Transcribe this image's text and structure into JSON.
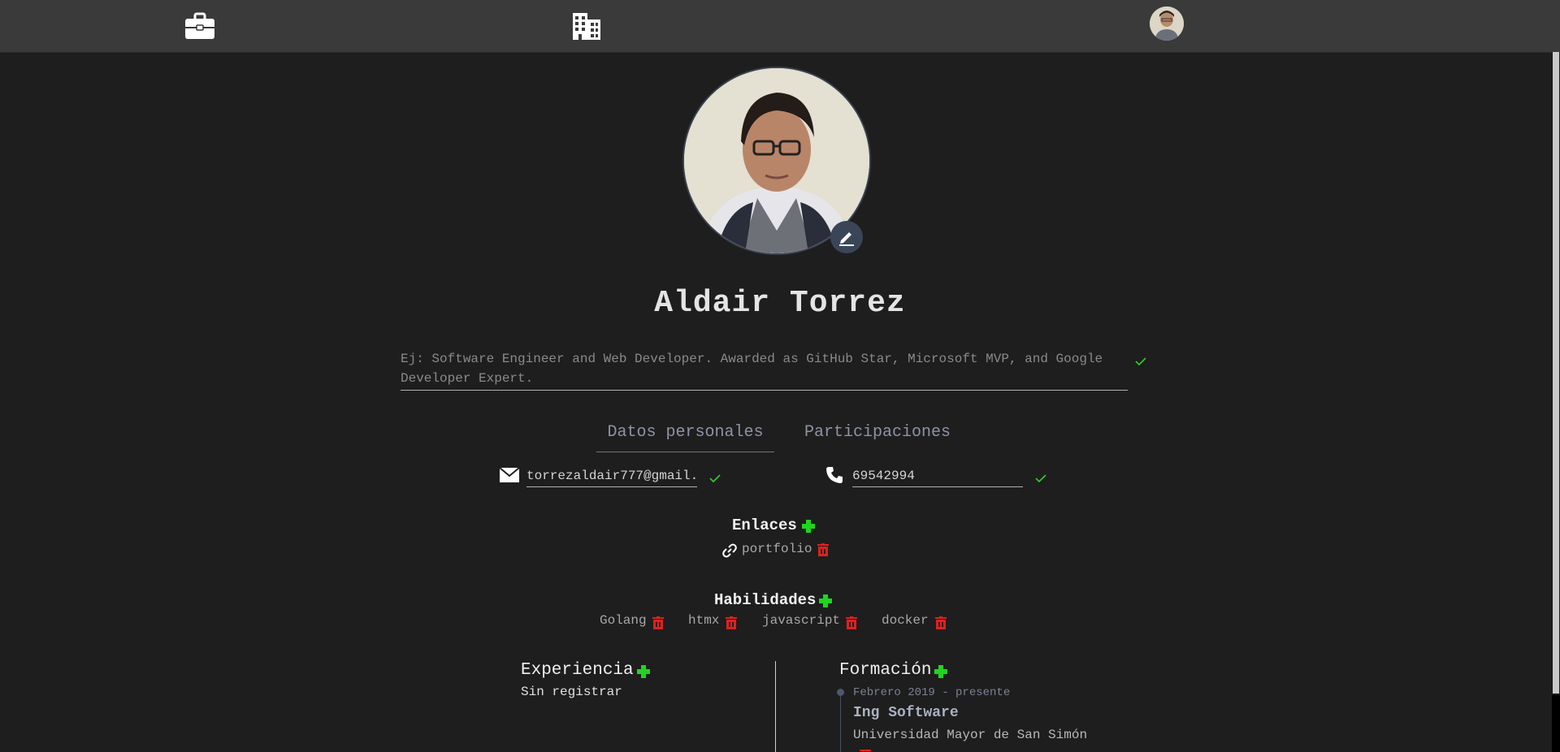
{
  "nav": {
    "jobs_icon": "briefcase-icon",
    "companies_icon": "building-icon",
    "avatar_icon": "user-avatar"
  },
  "profile": {
    "name": "Aldair Torrez",
    "bio_placeholder": "Ej: Software Engineer and Web Developer. Awarded as GitHub Star, Microsoft MVP, and Google Developer Expert."
  },
  "tabs": [
    {
      "label": "Datos personales",
      "active": true
    },
    {
      "label": "Participaciones",
      "active": false
    }
  ],
  "contact": {
    "email": "torrezaldair777@gmail.",
    "phone": "69542994"
  },
  "links": {
    "title": "Enlaces",
    "items": [
      {
        "label": "portfolio"
      }
    ]
  },
  "skills": {
    "title": "Habilidades",
    "items": [
      "Golang",
      "htmx",
      "javascript",
      "docker"
    ]
  },
  "experience": {
    "title": "Experiencia",
    "empty": "Sin registrar"
  },
  "education": {
    "title": "Formación",
    "items": [
      {
        "period": "Febrero 2019 - presente",
        "degree": "Ing Software",
        "institution": "Universidad Mayor de San Simón"
      }
    ]
  },
  "colors": {
    "background": "#1e1e1e",
    "topbar": "#3a3a3a",
    "accent_add": "#1fd51f",
    "accent_delete": "#e02020",
    "check": "#2fcf2f"
  }
}
